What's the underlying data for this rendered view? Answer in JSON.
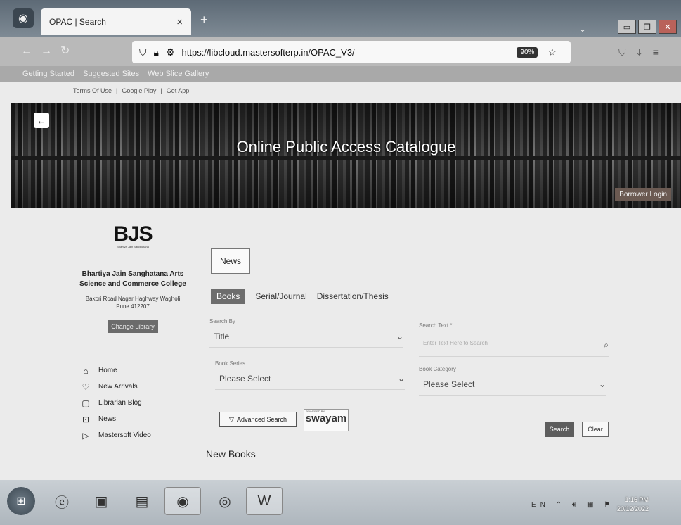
{
  "browser": {
    "tab_title": "OPAC | Search",
    "tab_close": "×",
    "new_tab": "+",
    "url": "https://libcloud.mastersofterp.in/OPAC_V3/",
    "zoom": "90%",
    "bookmarks": [
      "Getting Started",
      "Suggested Sites",
      "Web Slice Gallery"
    ]
  },
  "page": {
    "top_links": [
      "Terms Of Use",
      "|",
      "Google Play",
      "|",
      "Get App"
    ],
    "banner_title": "Online Public Access Catalogue",
    "borrower_login": "Borrower Login",
    "back_arrow": "←"
  },
  "sidebar": {
    "logo": "BJS",
    "logo_sub": "Bhartiya Jain Sanghatana",
    "college_name_line1": "Bhartiya Jain Sanghatana Arts",
    "college_name_line2": "Science and Commerce College",
    "address_line1": "Bakori Road Nagar Haghway Wagholi",
    "address_line2": "Pune 412207",
    "change_library": "Change Library",
    "menu": [
      {
        "label": "Home",
        "icon": "⌂"
      },
      {
        "label": "New Arrivals",
        "icon": "♡"
      },
      {
        "label": "Librarian Blog",
        "icon": "▢"
      },
      {
        "label": "News",
        "icon": "⊡"
      },
      {
        "label": "Mastersoft Video",
        "icon": "▷"
      }
    ]
  },
  "main": {
    "news_button": "News",
    "tabs": [
      "Books",
      "Serial/Journal",
      "Dissertation/Thesis"
    ],
    "search_by_label": "Search By",
    "search_by_value": "Title",
    "search_text_label": "Search Text *",
    "search_text_placeholder": "Enter Text Here to Search",
    "book_series_label": "Book Series",
    "book_series_value": "Please Select",
    "book_category_label": "Book Category",
    "book_category_value": "Please Select",
    "advanced_search": "Advanced Search",
    "swayam_powered": "POWERED BY",
    "swayam": "swayam",
    "search_button": "Search",
    "clear_button": "Clear",
    "new_books_heading": "New Books"
  },
  "taskbar": {
    "tray_lang": "EN",
    "time": "1:16 PM",
    "date": "20/12/2022"
  }
}
